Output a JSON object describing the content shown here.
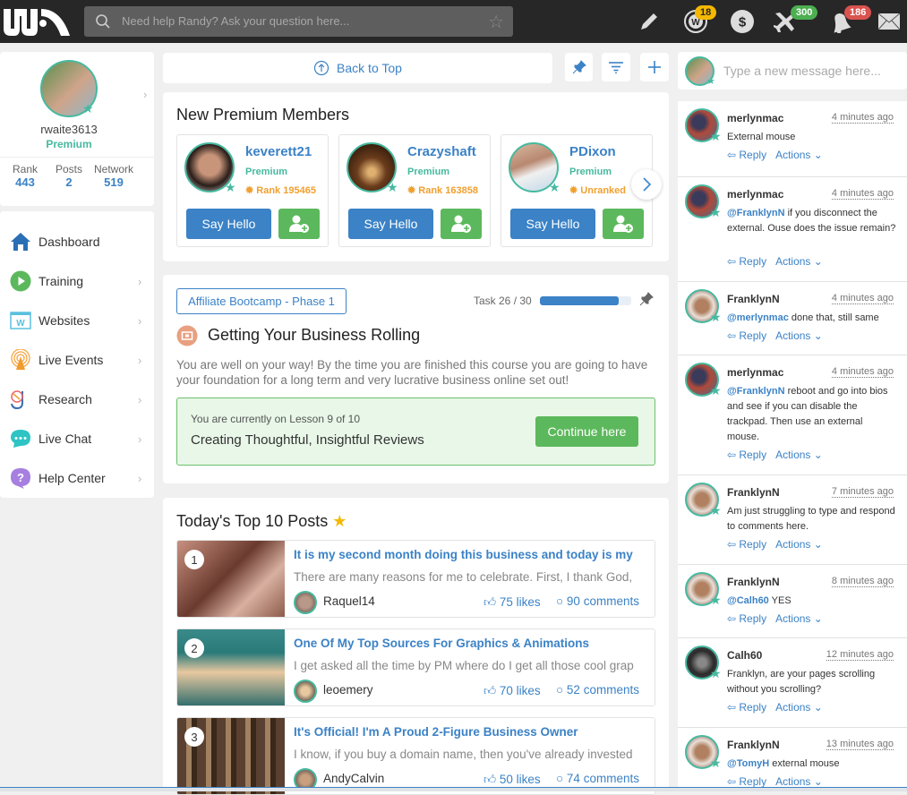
{
  "topbar": {
    "search_placeholder": "Need help Randy? Ask your question here...",
    "badges": {
      "wa": "18",
      "flights": "300",
      "notifications": "186"
    },
    "colors": {
      "wa_badge": "#f5b800",
      "flights_badge": "#4caf50",
      "notifications_badge": "#d9534f"
    }
  },
  "profile": {
    "username": "rwaite3613",
    "membership": "Premium",
    "stats": [
      {
        "label": "Rank",
        "value": "443"
      },
      {
        "label": "Posts",
        "value": "2"
      },
      {
        "label": "Network",
        "value": "519"
      }
    ]
  },
  "nav": {
    "items": [
      {
        "label": "Dashboard",
        "icon": "home-icon"
      },
      {
        "label": "Training",
        "icon": "play-icon"
      },
      {
        "label": "Websites",
        "icon": "website-icon"
      },
      {
        "label": "Live Events",
        "icon": "broadcast-icon"
      },
      {
        "label": "Research",
        "icon": "research-icon"
      },
      {
        "label": "Live Chat",
        "icon": "chat-icon"
      },
      {
        "label": "Help Center",
        "icon": "help-icon"
      }
    ]
  },
  "toolbar": {
    "back_to_top": "Back to Top"
  },
  "premium_members": {
    "title": "New Premium Members",
    "say_hello": "Say Hello",
    "members": [
      {
        "name": "keverett21",
        "status": "Premium",
        "rank": "Rank 195465"
      },
      {
        "name": "Crazyshaft",
        "status": "Premium",
        "rank": "Rank 163858"
      },
      {
        "name": "PDixon",
        "status": "Premium",
        "rank": "Unranked"
      }
    ]
  },
  "training": {
    "course": "Affiliate Bootcamp - Phase 1",
    "task_label": "Task 26 / 30",
    "task_progress": 0.867,
    "title": "Getting Your Business Rolling",
    "description": "You are well on your way! By the time you are finished this course you are going to have your foundation for a long term and very lucrative business online set out!",
    "lesson_status": "You are currently on Lesson 9 of 10",
    "lesson_title": "Creating Thoughtful, Insightful Reviews",
    "continue_label": "Continue here"
  },
  "top_posts": {
    "title": "Today's Top 10 Posts",
    "posts": [
      {
        "rank": "1",
        "title": "It is my second month doing this business and today is my",
        "excerpt": "There are many reasons for me to celebrate. First, I thank God,",
        "author": "Raquel14",
        "likes": "75 likes",
        "comments": "90 comments"
      },
      {
        "rank": "2",
        "title": "One Of My Top Sources For Graphics & Animations",
        "excerpt": "I get asked all the time by PM where do I get all those cool grap",
        "author": "leoemery",
        "likes": "70 likes",
        "comments": "52 comments"
      },
      {
        "rank": "3",
        "title": "It's Official! I'm A Proud 2-Figure Business Owner",
        "excerpt": "I know, if you buy a domain name, then you've already invested",
        "author": "AndyCalvin",
        "likes": "50 likes",
        "comments": "74 comments"
      }
    ]
  },
  "chat": {
    "input_placeholder": "Type a new message here...",
    "reply_label": "Reply",
    "actions_label": "Actions",
    "comments": [
      {
        "author": "merlynmac",
        "time": "4 minutes ago",
        "mention": "",
        "text": "External mouse"
      },
      {
        "author": "merlynmac",
        "time": "4 minutes ago",
        "mention": "@FranklynN",
        "text": " if you disconnect the external. Ouse does the issue remain?"
      },
      {
        "author": "FranklynN",
        "time": "4 minutes ago",
        "mention": "@merlynmac",
        "text": " done that, still same"
      },
      {
        "author": "merlynmac",
        "time": "4 minutes ago",
        "mention": "@FranklynN",
        "text": " reboot and go into bios and see if you can disable the trackpad. Then use an external mouse."
      },
      {
        "author": "FranklynN",
        "time": "7 minutes ago",
        "mention": "",
        "text": "Am just struggling to type and respond to comments here."
      },
      {
        "author": "FranklynN",
        "time": "8 minutes ago",
        "mention": "@Calh60",
        "text": " YES"
      },
      {
        "author": "Calh60",
        "time": "12 minutes ago",
        "mention": "",
        "text": "Franklyn, are your pages scrolling without you scrolling?"
      },
      {
        "author": "FranklynN",
        "time": "13 minutes ago",
        "mention": "@TomyH",
        "text": " external mouse"
      }
    ]
  }
}
